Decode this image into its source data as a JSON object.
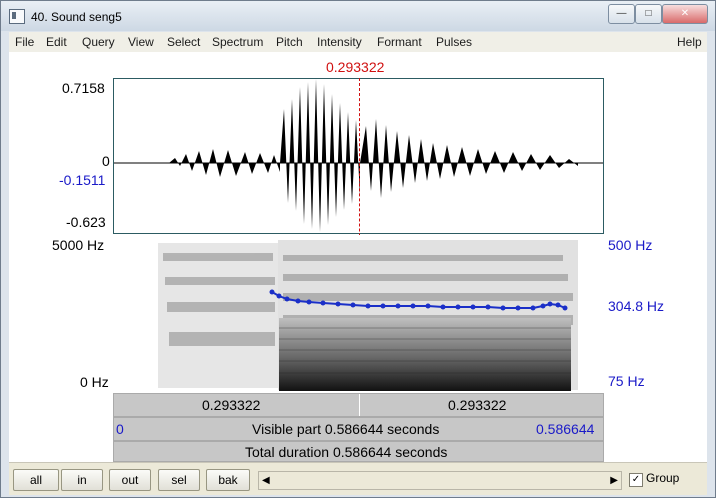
{
  "window": {
    "title": "40. Sound seng5",
    "controls": {
      "minimize": "—",
      "restore": "□",
      "close": "✕"
    }
  },
  "menu": [
    "File",
    "Edit",
    "Query",
    "View",
    "Select",
    "Spectrum",
    "Pitch",
    "Intensity",
    "Formant",
    "Pulses",
    "Help"
  ],
  "cursor": {
    "time": "0.293322"
  },
  "waveform": {
    "max": "0.7158",
    "zero": "0",
    "local_value": "-0.1511",
    "min": "-0.623"
  },
  "spectrogram": {
    "top_freq": "5000 Hz",
    "bottom_freq": "0 Hz",
    "pitch_top": "500 Hz",
    "pitch_current": "304.8 Hz",
    "pitch_bottom": "75 Hz"
  },
  "selection": {
    "left": "0.293322",
    "right": "0.293322"
  },
  "visible": {
    "start": "0",
    "label": "Visible part 0.586644 seconds",
    "end": "0.586644"
  },
  "total": {
    "label": "Total duration 0.586644 seconds"
  },
  "buttons": {
    "all": "all",
    "in": "in",
    "out": "out",
    "sel": "sel",
    "bak": "bak"
  },
  "group": {
    "checked": true,
    "label": "Group"
  }
}
